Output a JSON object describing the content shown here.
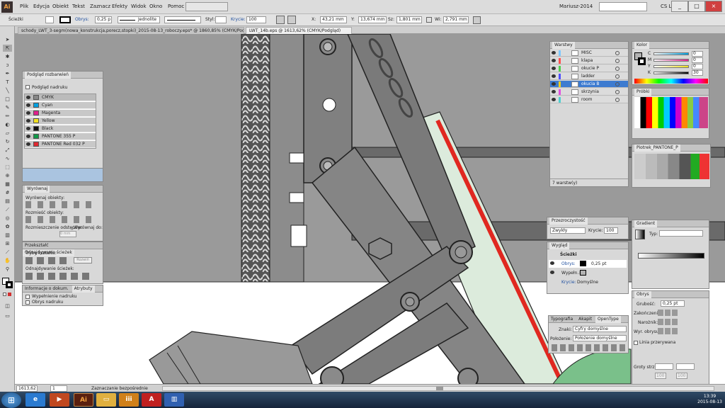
{
  "app": {
    "logo": "Ai",
    "workspace": "Mariusz-2014",
    "cs_live": "CS Live"
  },
  "menu": [
    "Plik",
    "Edycja",
    "Obiekt",
    "Tekst",
    "Zaznacz",
    "Efekty",
    "Widok",
    "Okno",
    "Pomoc"
  ],
  "control_bar": {
    "selection_label": "Ścieżki",
    "stroke_label": "Obrys:",
    "stroke_value": "0,25 p",
    "stroke_style": "Jednolite",
    "style_label": "Styl:",
    "opacity_label": "Krycie:",
    "opacity_value": "100",
    "x_label": "X:",
    "x_value": "43,21 mm",
    "y_label": "Y:",
    "y_value": "13,674 mm",
    "w_label": "Sz:",
    "w_value": "1,801 mm",
    "h_label": "Wi:",
    "h_value": "2,791 mm"
  },
  "doc_tabs": [
    "schody_LWT_3-segm(nowa_konstrukcja,porecz,stopki)_2015-08-13_roboczy.eps* @ 1860,85% (CMYK/Podgląd)",
    "LWT_14b.eps @ 1613,62% (CMYK/Podgląd)"
  ],
  "separations_panel": {
    "title": "Podgląd rozbarwień",
    "overprint": "Podgląd nadruku",
    "items": [
      {
        "name": "CMYK",
        "color": "#888888"
      },
      {
        "name": "Cyan",
        "color": "#00a0e0"
      },
      {
        "name": "Magenta",
        "color": "#e0208c"
      },
      {
        "name": "Yellow",
        "color": "#f0e020"
      },
      {
        "name": "Black",
        "color": "#111111"
      },
      {
        "name": "PANTONE 355 P",
        "color": "#109a48"
      },
      {
        "name": "PANTONE Red 032 P",
        "color": "#e02830"
      }
    ]
  },
  "align_panel": {
    "title": "Wyrównaj",
    "align_objects": "Wyrównaj obiekty:",
    "distribute_objects": "Rozmieść obiekty:",
    "distribute_spacing": "Rozmieszczenie odstępów:",
    "align_to": "Wyrównaj do:",
    "spacing_value": "0 mm"
  },
  "pathfinder_panel": {
    "tabs": [
      "Przekształć",
      "Odnajdywanie ścieżek"
    ],
    "shape_modes": "Tryby kształtu:",
    "pathfinders": "Odnajdywanie ścieżek:",
    "expand": "Rozwiń"
  },
  "attributes_panel": {
    "tabs": [
      "Informacje o dokum.",
      "Atrybuty"
    ],
    "fill_overprint": "Wypełnienie nadruku",
    "stroke_overprint": "Obrys nadruku"
  },
  "layers_panel": {
    "title": "Warstwy",
    "layers": [
      {
        "name": "MISC",
        "color": "#7ec8ff",
        "selected": false
      },
      {
        "name": "klapa",
        "color": "#ff5050",
        "selected": false
      },
      {
        "name": "okucie P",
        "color": "#50d050",
        "selected": false
      },
      {
        "name": "ladder",
        "color": "#5050ff",
        "selected": false
      },
      {
        "name": "okucia B",
        "color": "#f0d020",
        "selected": true
      },
      {
        "name": "skrzynia",
        "color": "#e050e0",
        "selected": false
      },
      {
        "name": "room",
        "color": "#50d0d0",
        "selected": false
      }
    ],
    "count": "7 warstw(y)"
  },
  "color_panel": {
    "title": "Kolor",
    "channels": [
      {
        "label": "C",
        "value": "0"
      },
      {
        "label": "M",
        "value": "0"
      },
      {
        "label": "Y",
        "value": "0"
      },
      {
        "label": "K",
        "value": "30"
      }
    ]
  },
  "swatches_panel": {
    "title": "Próbki"
  },
  "pantone_panel": {
    "title": "Piotrek_PANTONE_P"
  },
  "transparency_panel": {
    "title": "Przezroczystość",
    "mode": "Zwykły",
    "opacity_label": "Krycie:",
    "opacity_value": "100"
  },
  "gradient_panel": {
    "title": "Gradient",
    "type_label": "Typ:"
  },
  "appearance_panel": {
    "title": "Wygląd",
    "object": "Ścieżki",
    "stroke_label": "Obrys:",
    "stroke_value": "0,25 pt",
    "fill_label": "Wypełn.:",
    "opacity_label": "Krycie:",
    "opacity_value": "Domyślne"
  },
  "stroke_panel": {
    "title": "Obrys",
    "weight_label": "Grubość:",
    "weight_value": "0,25 pt",
    "cap_label": "Zakończenie:",
    "corner_label": "Narożnik:",
    "align_label": "Wyr. obrysu:",
    "dashed": "Linia przerywana",
    "arrowheads": "Groty strz.:",
    "scale_a": "100",
    "scale_b": "100"
  },
  "opentype_panel": {
    "tabs": [
      "Typografia",
      "Akapit",
      "OpenType"
    ],
    "figure_label": "Znaki:",
    "figure_value": "Cyfry domyślne",
    "position_label": "Położenie:",
    "position_value": "Położenie domyślne"
  },
  "status_bar": {
    "zoom": "1613,62",
    "page": "1",
    "tool": "Zaznaczanie bezpośrednie"
  },
  "taskbar": {
    "time": "13:39",
    "date": "2015-08-13"
  }
}
